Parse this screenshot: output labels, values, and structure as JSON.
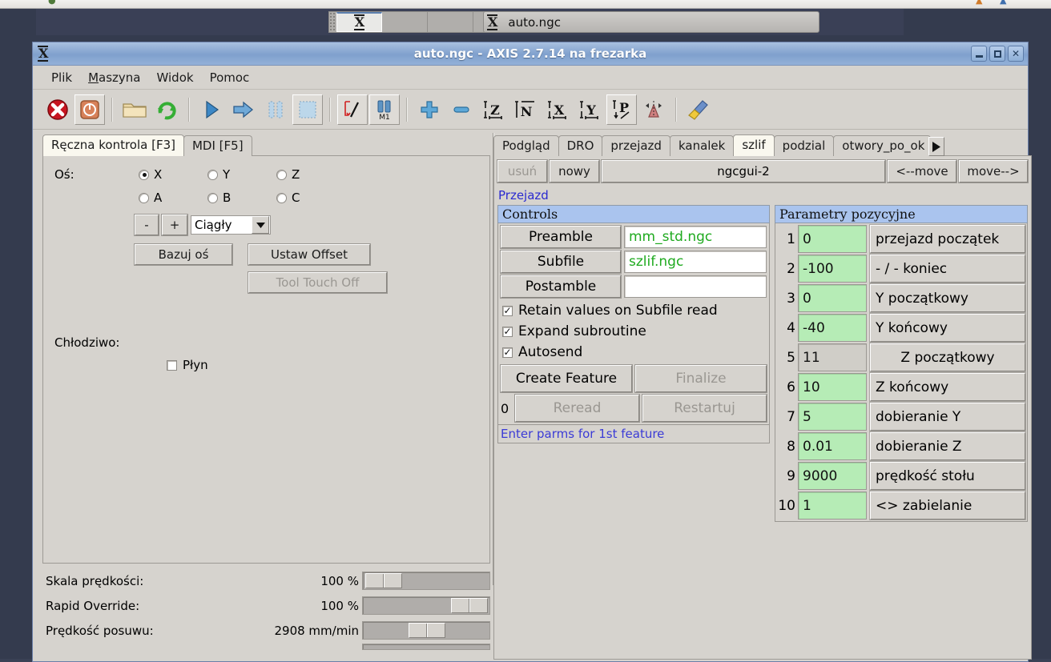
{
  "taskbar": {
    "camera_icon": "camera-folder-icon",
    "window_button_label": "auto.ngc",
    "app_icon": "x-logo-icon"
  },
  "window": {
    "icon": "x-logo-icon",
    "title": "auto.ngc - AXIS 2.7.14 na frezarka",
    "buttons": {
      "minimize": "minimize-icon",
      "maximize": "maximize-icon",
      "close": "close-icon"
    }
  },
  "menubar": [
    {
      "label": "Plik",
      "mnemonic": ""
    },
    {
      "label": "Maszyna",
      "mnemonic": "M"
    },
    {
      "label": "Widok",
      "mnemonic": ""
    },
    {
      "label": "Pomoc",
      "mnemonic": ""
    }
  ],
  "toolbar": [
    {
      "name": "estop-icon"
    },
    {
      "name": "machine-power-icon"
    },
    {
      "name": "open-file-icon"
    },
    {
      "name": "reload-file-icon"
    },
    {
      "name": "run-program-icon"
    },
    {
      "name": "step-program-icon"
    },
    {
      "name": "pause-program-icon"
    },
    {
      "name": "stop-program-icon"
    },
    {
      "name": "toggle-skip-lines-icon"
    },
    {
      "name": "toggle-optional-stop-icon"
    },
    {
      "name": "zoom-in-icon"
    },
    {
      "name": "zoom-out-icon"
    },
    {
      "name": "view-z-icon"
    },
    {
      "name": "view-z2-icon"
    },
    {
      "name": "view-x-icon"
    },
    {
      "name": "view-y-icon"
    },
    {
      "name": "view-p-icon"
    },
    {
      "name": "tool-cone-icon"
    },
    {
      "name": "clear-plot-icon"
    }
  ],
  "left_panel": {
    "tabs": [
      {
        "label": "Ręczna kontrola [F3]",
        "selected": true
      },
      {
        "label": "MDI [F5]",
        "selected": false
      }
    ],
    "axis_label": "Oś:",
    "axes": [
      {
        "label": "X",
        "selected": true
      },
      {
        "label": "Y",
        "selected": false
      },
      {
        "label": "Z",
        "selected": false
      },
      {
        "label": "A",
        "selected": false
      },
      {
        "label": "B",
        "selected": false
      },
      {
        "label": "C",
        "selected": false
      }
    ],
    "jog_minus": "-",
    "jog_plus": "+",
    "jog_mode": "Ciągły",
    "home_axis_button": "Bazuj oś",
    "set_offset_button": "Ustaw Offset",
    "tool_touch_off_button": "Tool Touch Off",
    "coolant_label": "Chłodziwo:",
    "coolant_flood": "Płyn"
  },
  "sliders": [
    {
      "label": "Skala prędkości:",
      "value": "100 %",
      "pos": 5
    },
    {
      "label": "Rapid Override:",
      "value": "100 %",
      "pos": 68
    },
    {
      "label": "Prędkość posuwu:",
      "value": "2908 mm/min",
      "pos": 36
    }
  ],
  "right_panel": {
    "tabs": [
      {
        "label": "Podgląd",
        "selected": false
      },
      {
        "label": "DRO",
        "selected": false
      },
      {
        "label": "przejazd",
        "selected": false
      },
      {
        "label": "kanalek",
        "selected": false
      },
      {
        "label": "szlif",
        "selected": true
      },
      {
        "label": "podzial",
        "selected": false
      },
      {
        "label": "otwory_po_ok",
        "selected": false
      }
    ],
    "tab_scroll_icon": "chevron-right-icon",
    "delete_button": "usuń",
    "new_button": "nowy",
    "page_name": "ngcgui-2",
    "move_left_button": "<--move",
    "move_right_button": "move-->",
    "feature_link": "Przejazd",
    "controls": {
      "title": "Controls",
      "rows": [
        {
          "button": "Preamble",
          "value": "mm_std.ngc"
        },
        {
          "button": "Subfile",
          "value": "szlif.ngc"
        },
        {
          "button": "Postamble",
          "value": ""
        }
      ],
      "checks": [
        {
          "label": "Retain values on Subfile read",
          "checked": true
        },
        {
          "label": "Expand subroutine",
          "checked": true
        },
        {
          "label": "Autosend",
          "checked": true
        }
      ],
      "create_feature_button": "Create Feature",
      "finalize_button": "Finalize",
      "count": "0",
      "reread_button": "Reread",
      "restart_button": "Restartuj",
      "status": "Enter parms for 1st feature"
    },
    "params": {
      "title": "Parametry pozycyjne",
      "rows": [
        {
          "n": "1",
          "value": "0",
          "label": "przejazd początek",
          "focused": false
        },
        {
          "n": "2",
          "value": "-100",
          "label": "- / -   koniec",
          "focused": false
        },
        {
          "n": "3",
          "value": "0",
          "label": "Y początkowy",
          "focused": false
        },
        {
          "n": "4",
          "value": "-40",
          "label": "Y końcowy",
          "focused": false
        },
        {
          "n": "5",
          "value": "11",
          "label": "Z początkowy",
          "focused": true
        },
        {
          "n": "6",
          "value": "10",
          "label": "Z końcowy",
          "focused": false
        },
        {
          "n": "7",
          "value": "5",
          "label": "dobieranie Y",
          "focused": false
        },
        {
          "n": "8",
          "value": "0.01",
          "label": "dobieranie Z",
          "focused": false
        },
        {
          "n": "9",
          "value": "9000",
          "label": "prędkość stołu",
          "focused": false
        },
        {
          "n": "10",
          "value": "1",
          "label": "<> zabielanie",
          "focused": false
        }
      ]
    }
  },
  "colors": {
    "desktop": "#343b4e",
    "window_face": "#d6d3ce",
    "title_gradient_top": "#a8c0e0",
    "title_gradient_bottom": "#7fa0cd",
    "panel_header": "#aac4ee",
    "entry_green_text": "#1faa1f",
    "param_value_bg": "#b6ecb6",
    "link_blue": "#2a2ad0",
    "status_blue": "#3b3bd6",
    "selected_tab": "#faf8ef"
  }
}
